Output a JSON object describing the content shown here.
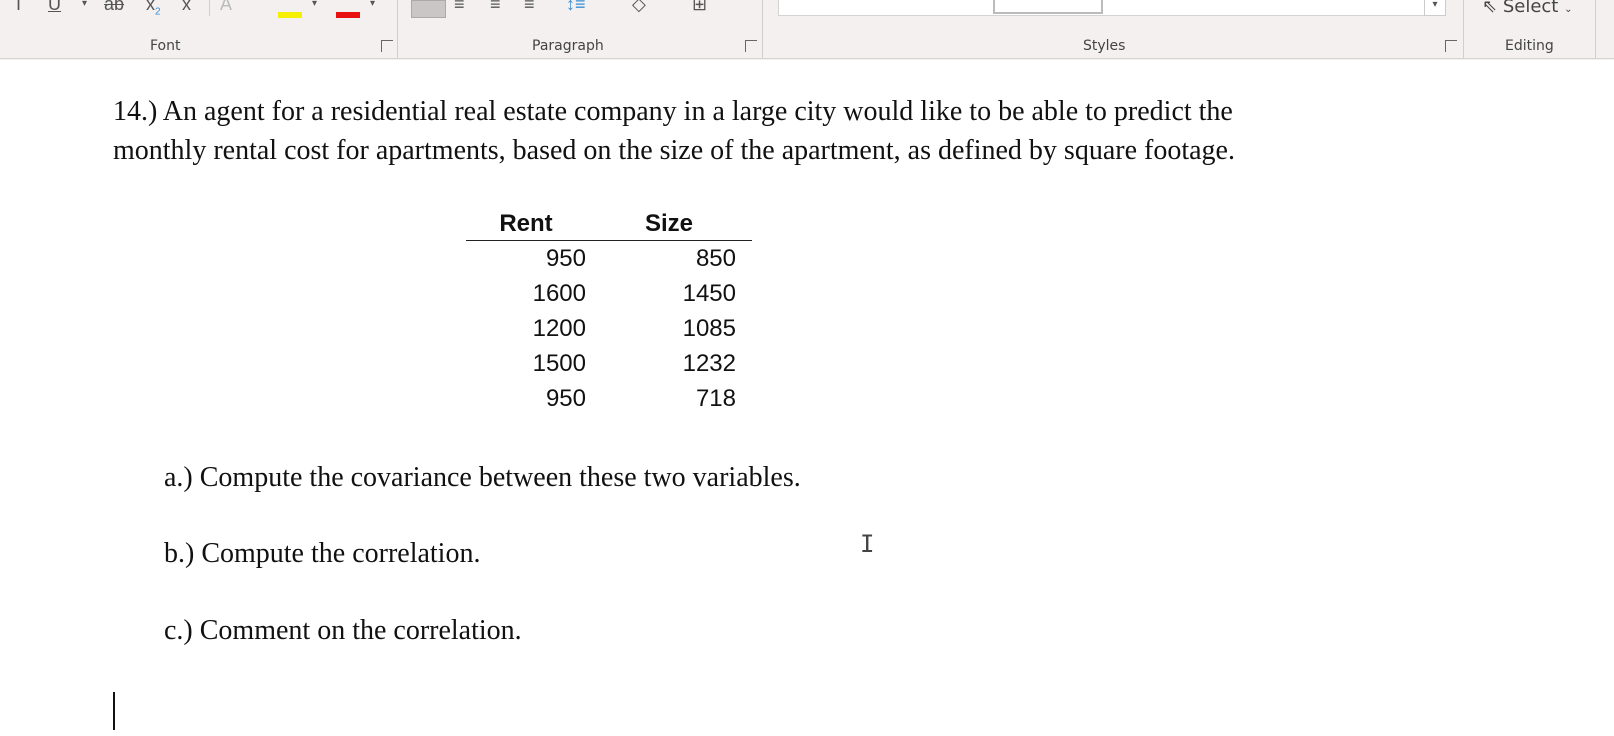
{
  "ribbon": {
    "groups": {
      "font": "Font",
      "paragraph": "Paragraph",
      "styles": "Styles",
      "editing": "Editing"
    },
    "select_label": "Select",
    "highlight_color": "#f5f000",
    "font_color": "#e81010"
  },
  "document": {
    "question_intro": "14.)  An agent for a residential real estate company in a large city would like to be able to predict the",
    "question_intro_2": "monthly rental cost for apartments, based on the size of the apartment, as defined by square footage.",
    "table": {
      "headers": [
        "Rent",
        "Size"
      ],
      "rows": [
        [
          "950",
          "850"
        ],
        [
          "1600",
          "1450"
        ],
        [
          "1200",
          "1085"
        ],
        [
          "1500",
          "1232"
        ],
        [
          "950",
          "718"
        ]
      ]
    },
    "questions": [
      "a.)  Compute the covariance between these two variables.",
      "b.) Compute the correlation.",
      "c.)  Comment on the correlation."
    ]
  }
}
